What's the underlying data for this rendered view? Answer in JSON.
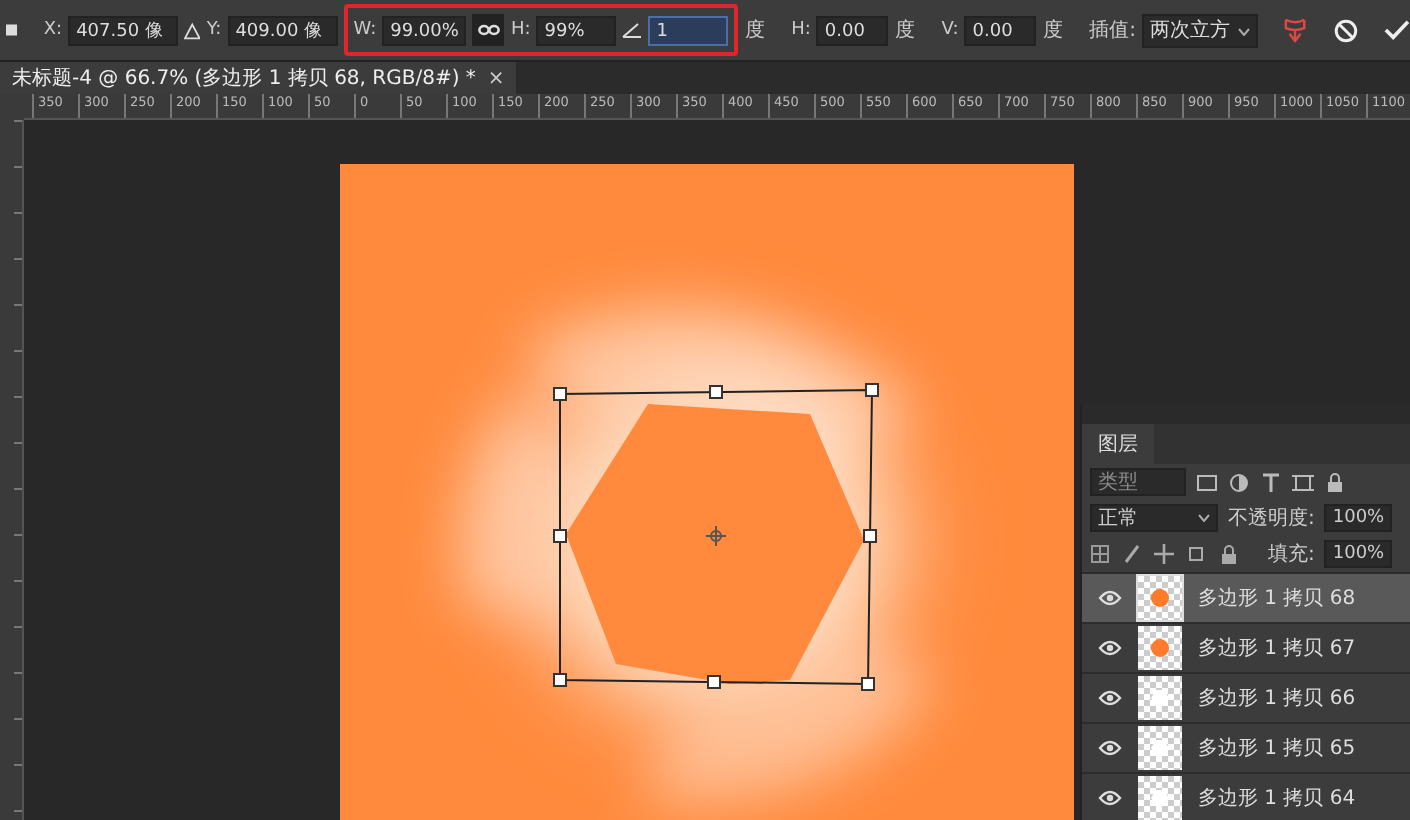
{
  "options_bar": {
    "x_label": "X:",
    "x_value": "407.50 像",
    "y_label": "Y:",
    "y_value": "409.00 像",
    "w_label": "W:",
    "w_value": "99.00%",
    "link": {
      "selected": true
    },
    "h_label": "H:",
    "h_value": "99%",
    "angle_value": "1",
    "angle_unit": "度",
    "hskew_label": "H:",
    "hskew_value": "0.00",
    "hskew_unit": "度",
    "vskew_label": "V:",
    "vskew_value": "0.00",
    "vskew_unit": "度",
    "interp_label": "插值:",
    "interp_value": "两次立方"
  },
  "document_tab": {
    "title": "未标题-4 @ 66.7% (多边形 1 拷贝 68, RGB/8#) *",
    "close": "×",
    "selected": true
  },
  "ruler": {
    "labels": [
      "350",
      "300",
      "250",
      "200",
      "150",
      "100",
      "50",
      "0",
      "50",
      "100",
      "150",
      "200",
      "250",
      "300",
      "350",
      "400",
      "450",
      "500",
      "550",
      "600",
      "650",
      "700",
      "750",
      "800",
      "850",
      "900",
      "950",
      "1000",
      "1050",
      "1100"
    ]
  },
  "layers_panel": {
    "title": "图层",
    "filter_placeholder": "类型",
    "blend_mode": "正常",
    "opacity_label": "不透明度:",
    "opacity_value": "100%",
    "fill_label": "填充:",
    "fill_value": "100%",
    "layers": [
      {
        "name": "多边形 1 拷贝 68",
        "visible": true,
        "selected": true,
        "kind": "filled"
      },
      {
        "name": "多边形 1 拷贝 67",
        "visible": true,
        "selected": false,
        "kind": "filled"
      },
      {
        "name": "多边形 1 拷贝 66",
        "visible": true,
        "selected": false,
        "kind": "empty"
      },
      {
        "name": "多边形 1 拷贝 65",
        "visible": true,
        "selected": false,
        "kind": "empty"
      },
      {
        "name": "多边形 1 拷贝 64",
        "visible": true,
        "selected": false,
        "kind": "empty"
      }
    ]
  }
}
